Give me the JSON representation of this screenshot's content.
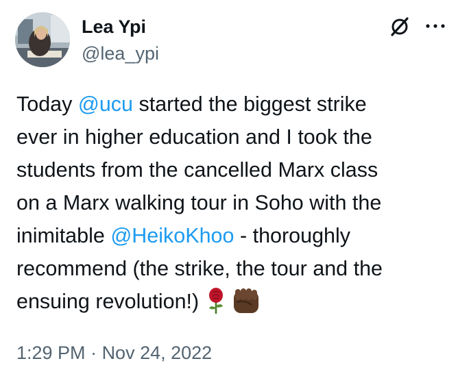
{
  "author": {
    "display_name": "Lea Ypi",
    "handle": "@lea_ypi"
  },
  "header_icons": {
    "logo": "x-logo-icon",
    "more": "more-options-icon"
  },
  "tweet": {
    "line1": {
      "before": "Today ",
      "mention": "@ucu",
      "after": " started the biggest strike"
    },
    "line2": "ever in higher education and I took the",
    "line3": "students from the cancelled Marx class",
    "line4": "on a Marx walking tour in Soho with the",
    "line5": {
      "before": "inimitable ",
      "mention": "@HeikoKhoo",
      "after": " - thoroughly"
    },
    "line6": "recommend (the strike, the tour and the",
    "line7": {
      "text": "ensuing revolution!)"
    },
    "emojis": [
      "rose-icon",
      "raised-fist-icon"
    ]
  },
  "meta": {
    "time": "1:29 PM",
    "separator": " · ",
    "date": "Nov 24, 2022"
  },
  "colors": {
    "text": "#0f1419",
    "secondary": "#536471",
    "link": "#1d9bf0"
  }
}
